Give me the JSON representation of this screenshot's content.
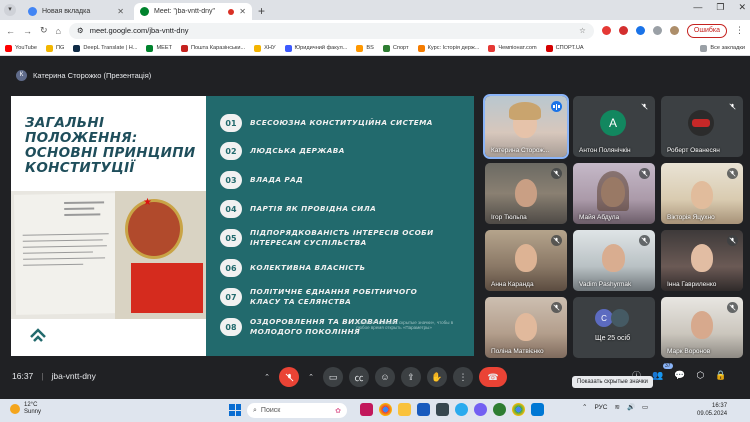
{
  "browser": {
    "tabs": [
      {
        "title": "Новая вкладка",
        "active": false
      },
      {
        "title": "Meet: \"jba-vntt-dny\"",
        "active": true
      }
    ],
    "url": "meet.google.com/jba-vntt-dny",
    "error_button": "Ошибка",
    "bookmarks": [
      "YouTube",
      "ПG",
      "DeepL Translate | Н...",
      "MEET",
      "Пошта Каразінськи...",
      "ХНУ",
      "Юридичний факул...",
      "BS",
      "Спорт",
      "Курс: Історія держ...",
      "Чемпіонат.com",
      "СПОРТ.UA"
    ],
    "all_bookmarks": "Все закладки"
  },
  "meet": {
    "presenter_initial": "К",
    "presenter_label": "Катерина Сторожко (Презентація)",
    "meeting_time": "16:37",
    "meeting_code": "jba-vntt-dny",
    "tooltip": "Показать скрытые значки",
    "people_count": "37"
  },
  "slide": {
    "title": "ЗАГАЛЬНІ ПОЛОЖЕННЯ: ОСНОВНІ ПРИНЦИПИ КОНСТИТУЦІЇ",
    "items": [
      {
        "num": "01",
        "text": "ВСЕСОЮЗНА КОНСТИТУЦІЙНА СИСТЕМА"
      },
      {
        "num": "02",
        "text": "ЛЮДСЬКА ДЕРЖАВА"
      },
      {
        "num": "03",
        "text": "ВЛАДА РАД"
      },
      {
        "num": "04",
        "text": "ПАРТІЯ ЯК ПРОВІДНА СИЛА"
      },
      {
        "num": "05",
        "text": " ПІДПОРЯДКОВАНІСТЬ ІНТЕРЕСІВ ОСОБИ ІНТЕРЕСАМ СУСПІЛЬСТВА"
      },
      {
        "num": "06",
        "text": "КОЛЕКТИВНА ВЛАСНІСТЬ"
      },
      {
        "num": "07",
        "text": " ПОЛІТИЧНЕ ЄДНАННЯ РОБІТНИЧОГО КЛАСУ ТА СЕЛЯНСТВА"
      },
      {
        "num": "08",
        "text": "ОЗДОРОВЛЕННЯ ТА ВИХОВАННЯ МОЛОДОГО ПОКОЛІННЯ"
      }
    ],
    "watermark": "Нажмите «Показать скрытые значки», чтобы в любое время открыть «Параметры»"
  },
  "participants": [
    {
      "name": "Катерина Сторож...",
      "speaking": true
    },
    {
      "name": "Антон Полянічкін",
      "initial": "A",
      "avatar_color": "#12875f"
    },
    {
      "name": "Роберт Ованесян"
    },
    {
      "name": "Ігор Тюльпа"
    },
    {
      "name": "Майя Абдула"
    },
    {
      "name": "Вікторія Яцухно"
    },
    {
      "name": "Анна Каранда"
    },
    {
      "name": "Vadim Pashyrmak"
    },
    {
      "name": "Інна Гавриленко"
    },
    {
      "name": "Поліна Матвієнко"
    },
    {
      "name": "Ще 25 осіб",
      "initial": "С"
    },
    {
      "name": "Марк Воронов"
    }
  ],
  "taskbar": {
    "temperature": "12°C",
    "weather": "Sunny",
    "search": "Поиск",
    "lang": "РУС",
    "time": "16:37",
    "date": "09.05.2024"
  },
  "colors": {
    "slide_teal": "#226a6d",
    "title_color": "#1f4e5b",
    "hangup_red": "#ea4335",
    "meet_bg": "#202124"
  }
}
